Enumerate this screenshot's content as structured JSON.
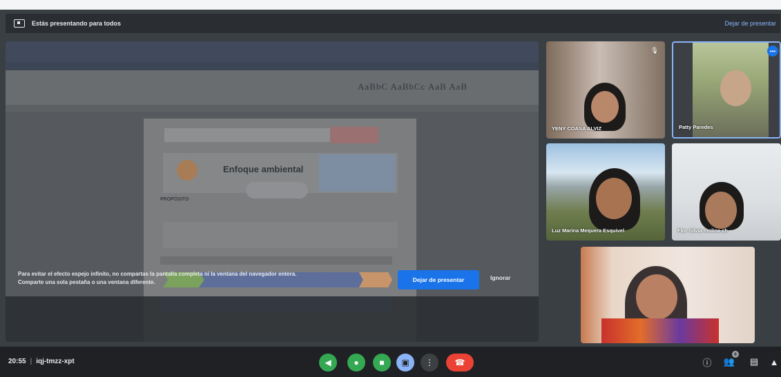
{
  "banner": {
    "presenting_text": "Estás presentando para todos",
    "stop_presenting_link": "Dejar de presentar"
  },
  "shared_document": {
    "ribbon_style_sample": "AaBbC AaBbCc AaB AaB",
    "section_title": "Enfoque ambiental",
    "proposito_label": "PROPÓSITO"
  },
  "warning": {
    "message": "Para evitar el efecto espejo infinito, no compartas la pantalla completa ni la ventana del navegador entera. Comparte una sola pestaña o una ventana diferente.",
    "stop_button": "Dejar de presentar",
    "ignore_button": "Ignorar"
  },
  "participants": [
    {
      "name": "YENY COASA ALVIZ",
      "muted": true
    },
    {
      "name": "Patty Paredes",
      "speaking": true
    },
    {
      "name": "Luz Marina Mequera Esquivel"
    },
    {
      "name": "Flor Silvia molina ch"
    },
    {
      "name": ""
    }
  ],
  "bottom_bar": {
    "time": "20:55",
    "meeting_code": "iqj-tmzz-xpt",
    "people_count": "6"
  },
  "colors": {
    "accent": "#1a73e8",
    "control_green": "#34a853",
    "hangup_red": "#ea4335",
    "bar_bg": "#202124"
  }
}
